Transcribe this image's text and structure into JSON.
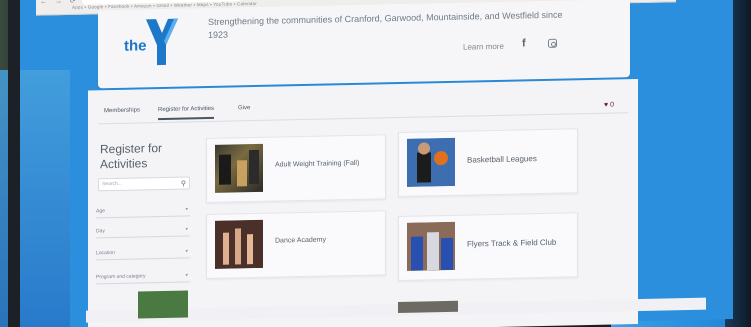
{
  "browser": {
    "nav": "←  →  ⟳  ⌂",
    "bookmarks": "Apps   ▪ Google   ▪ Facebook   ▪ Amazon   ▪ Gmail   ▪ Weather   ▪ Maps   ▪ YouTube   ▪ Calendar"
  },
  "header": {
    "logo_text": "the",
    "tagline": "Strengthening the communities of Cranford, Garwood, Mountainside, and Westfield since 1923",
    "learn_more": "Learn more",
    "facebook": "f"
  },
  "tabs": [
    {
      "label": "Memberships"
    },
    {
      "label": "Register for Activities"
    },
    {
      "label": "Give"
    }
  ],
  "heart": "♥ 0",
  "sidebar": {
    "title": "Register for Activities",
    "search_placeholder": "Search...",
    "filters": [
      {
        "label": "Age"
      },
      {
        "label": "Day"
      },
      {
        "label": "Location"
      },
      {
        "label": "Program and category"
      }
    ]
  },
  "activities": [
    {
      "title": "Adult Weight Training (Fall)"
    },
    {
      "title": "Basketball Leagues"
    },
    {
      "title": "Dance Academy"
    },
    {
      "title": "Flyers Track & Field Club"
    }
  ],
  "colors": {
    "ymca_blue": "#1d78c9",
    "screen_blue": "#2c8fde",
    "panel_bg": "#f4f4f7"
  }
}
